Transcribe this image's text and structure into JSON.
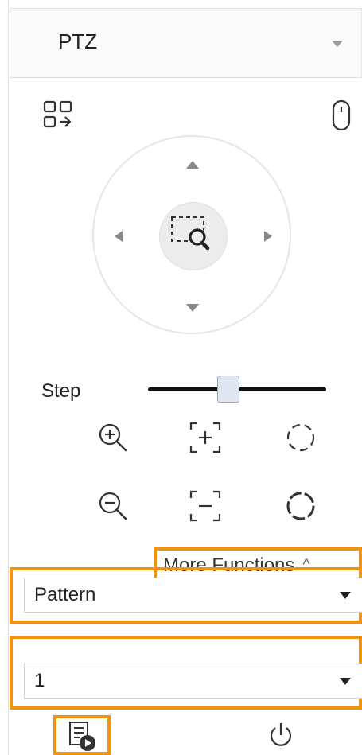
{
  "ptz_panel": {
    "title": "PTZ",
    "step_label": "Step",
    "step_value": 0.45,
    "more_functions_label": "More Functions",
    "function_select": {
      "value": "Pattern"
    },
    "number_select": {
      "value": "1"
    }
  },
  "colors": {
    "highlight": "#f0940f",
    "icon": "#333333"
  },
  "icons": [
    "grid-switch-icon",
    "mouse-icon",
    "up-arrow-icon",
    "down-arrow-icon",
    "left-arrow-icon",
    "right-arrow-icon",
    "zoom-area-icon",
    "zoom-in-icon",
    "focus-near-icon",
    "iris-small-icon",
    "zoom-out-icon",
    "focus-far-icon",
    "iris-large-icon",
    "chevron-up-icon",
    "pattern-record-icon",
    "power-icon"
  ]
}
